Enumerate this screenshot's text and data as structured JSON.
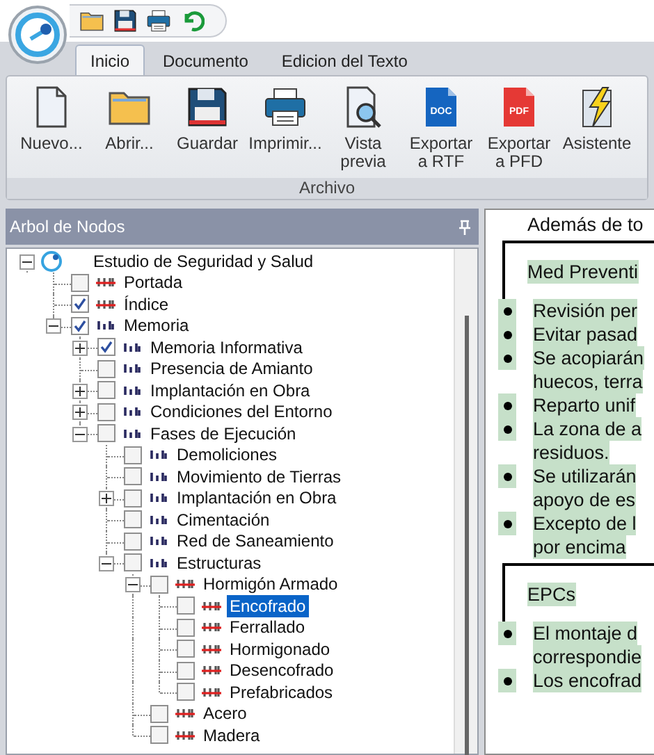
{
  "quick_access": [
    {
      "kind": "open"
    },
    {
      "kind": "save"
    },
    {
      "kind": "print"
    },
    {
      "kind": "undo"
    }
  ],
  "tabs": [
    {
      "label": "Inicio",
      "selected": true
    },
    {
      "label": "Documento",
      "selected": false
    },
    {
      "label": "Edicion del Texto",
      "selected": false
    }
  ],
  "ribbon": {
    "buttons": [
      {
        "kind": "new",
        "label": "Nuevo..."
      },
      {
        "kind": "open",
        "label": "Abrir..."
      },
      {
        "kind": "save",
        "label": "Guardar"
      },
      {
        "kind": "print",
        "label": "Imprimir..."
      },
      {
        "kind": "preview",
        "label": "Vista\nprevia"
      },
      {
        "kind": "doc",
        "label": "Exportar\na RTF",
        "badge": "DOC"
      },
      {
        "kind": "pdf",
        "label": "Exportar\na PFD",
        "badge": "PDF"
      },
      {
        "kind": "wizard",
        "label": "Asistente"
      }
    ],
    "group": "Archivo"
  },
  "tree_panel": {
    "title": "Arbol de Nodos",
    "items": [
      {
        "label": "Estudio de Seguridad y Salud",
        "kind": "root",
        "expanded": true,
        "selected": false,
        "children": [
          {
            "label": "Portada",
            "kind": "struck",
            "checked": false,
            "selected": false
          },
          {
            "label": "Índice",
            "kind": "struck",
            "checked": true,
            "selected": false
          },
          {
            "label": "Memoria",
            "kind": "plain",
            "checked": true,
            "expanded": true,
            "selected": false,
            "children": [
              {
                "label": "Memoria Informativa",
                "kind": "plain",
                "checked": true,
                "expanded": false,
                "selected": false
              },
              {
                "label": "Presencia de Amianto",
                "kind": "plain",
                "checked": false,
                "selected": false
              },
              {
                "label": "Implantación en Obra",
                "kind": "plain",
                "checked": false,
                "expanded": false,
                "selected": false
              },
              {
                "label": "Condiciones del Entorno",
                "kind": "plain",
                "checked": false,
                "expanded": false,
                "selected": false
              },
              {
                "label": "Fases de Ejecución",
                "kind": "plain",
                "checked": false,
                "expanded": true,
                "selected": false,
                "children": [
                  {
                    "label": "Demoliciones",
                    "kind": "plain",
                    "checked": false,
                    "selected": false
                  },
                  {
                    "label": "Movimiento de Tierras",
                    "kind": "plain",
                    "checked": false,
                    "selected": false
                  },
                  {
                    "label": "Implantación en Obra",
                    "kind": "plain",
                    "checked": false,
                    "expanded": false,
                    "selected": false
                  },
                  {
                    "label": "Cimentación",
                    "kind": "plain",
                    "checked": false,
                    "selected": false
                  },
                  {
                    "label": "Red de Saneamiento",
                    "kind": "plain",
                    "checked": false,
                    "selected": false
                  },
                  {
                    "label": "Estructuras",
                    "kind": "plain",
                    "checked": false,
                    "expanded": true,
                    "selected": false,
                    "children": [
                      {
                        "label": "Hormigón Armado",
                        "kind": "struck",
                        "checked": false,
                        "expanded": true,
                        "selected": false,
                        "children": [
                          {
                            "label": "Encofrado",
                            "kind": "struck",
                            "checked": false,
                            "selected": true
                          },
                          {
                            "label": "Ferrallado",
                            "kind": "struck",
                            "checked": false,
                            "selected": false
                          },
                          {
                            "label": "Hormigonado",
                            "kind": "struck",
                            "checked": false,
                            "selected": false
                          },
                          {
                            "label": "Desencofrado",
                            "kind": "struck",
                            "checked": false,
                            "selected": false
                          },
                          {
                            "label": "Prefabricados",
                            "kind": "struck",
                            "checked": false,
                            "selected": false
                          }
                        ]
                      },
                      {
                        "label": "Acero",
                        "kind": "struck",
                        "checked": false,
                        "selected": false
                      },
                      {
                        "label": "Madera",
                        "kind": "struck",
                        "checked": false,
                        "selected": false
                      }
                    ]
                  }
                ]
              }
            ]
          }
        ]
      }
    ]
  },
  "document": [
    {
      "kind": "text",
      "text": "Además de to"
    },
    {
      "kind": "section",
      "title": "Med Preventi",
      "items": [
        {
          "lines": [
            "Revisión per"
          ]
        },
        {
          "lines": [
            "Evitar pasad"
          ]
        },
        {
          "lines": [
            "Se acopiarán",
            "huecos, terra"
          ]
        },
        {
          "lines": [
            "Reparto unif"
          ]
        },
        {
          "lines": [
            "La zona de a",
            "residuos."
          ]
        },
        {
          "lines": [
            "Se utilizarán",
            "apoyo de es"
          ]
        },
        {
          "lines": [
            "Excepto de l",
            "por encima"
          ]
        }
      ]
    },
    {
      "kind": "section",
      "title": "EPCs",
      "items": [
        {
          "lines": [
            "El montaje d",
            "correspondie"
          ]
        },
        {
          "lines": [
            "Los encofrad"
          ]
        }
      ]
    }
  ]
}
